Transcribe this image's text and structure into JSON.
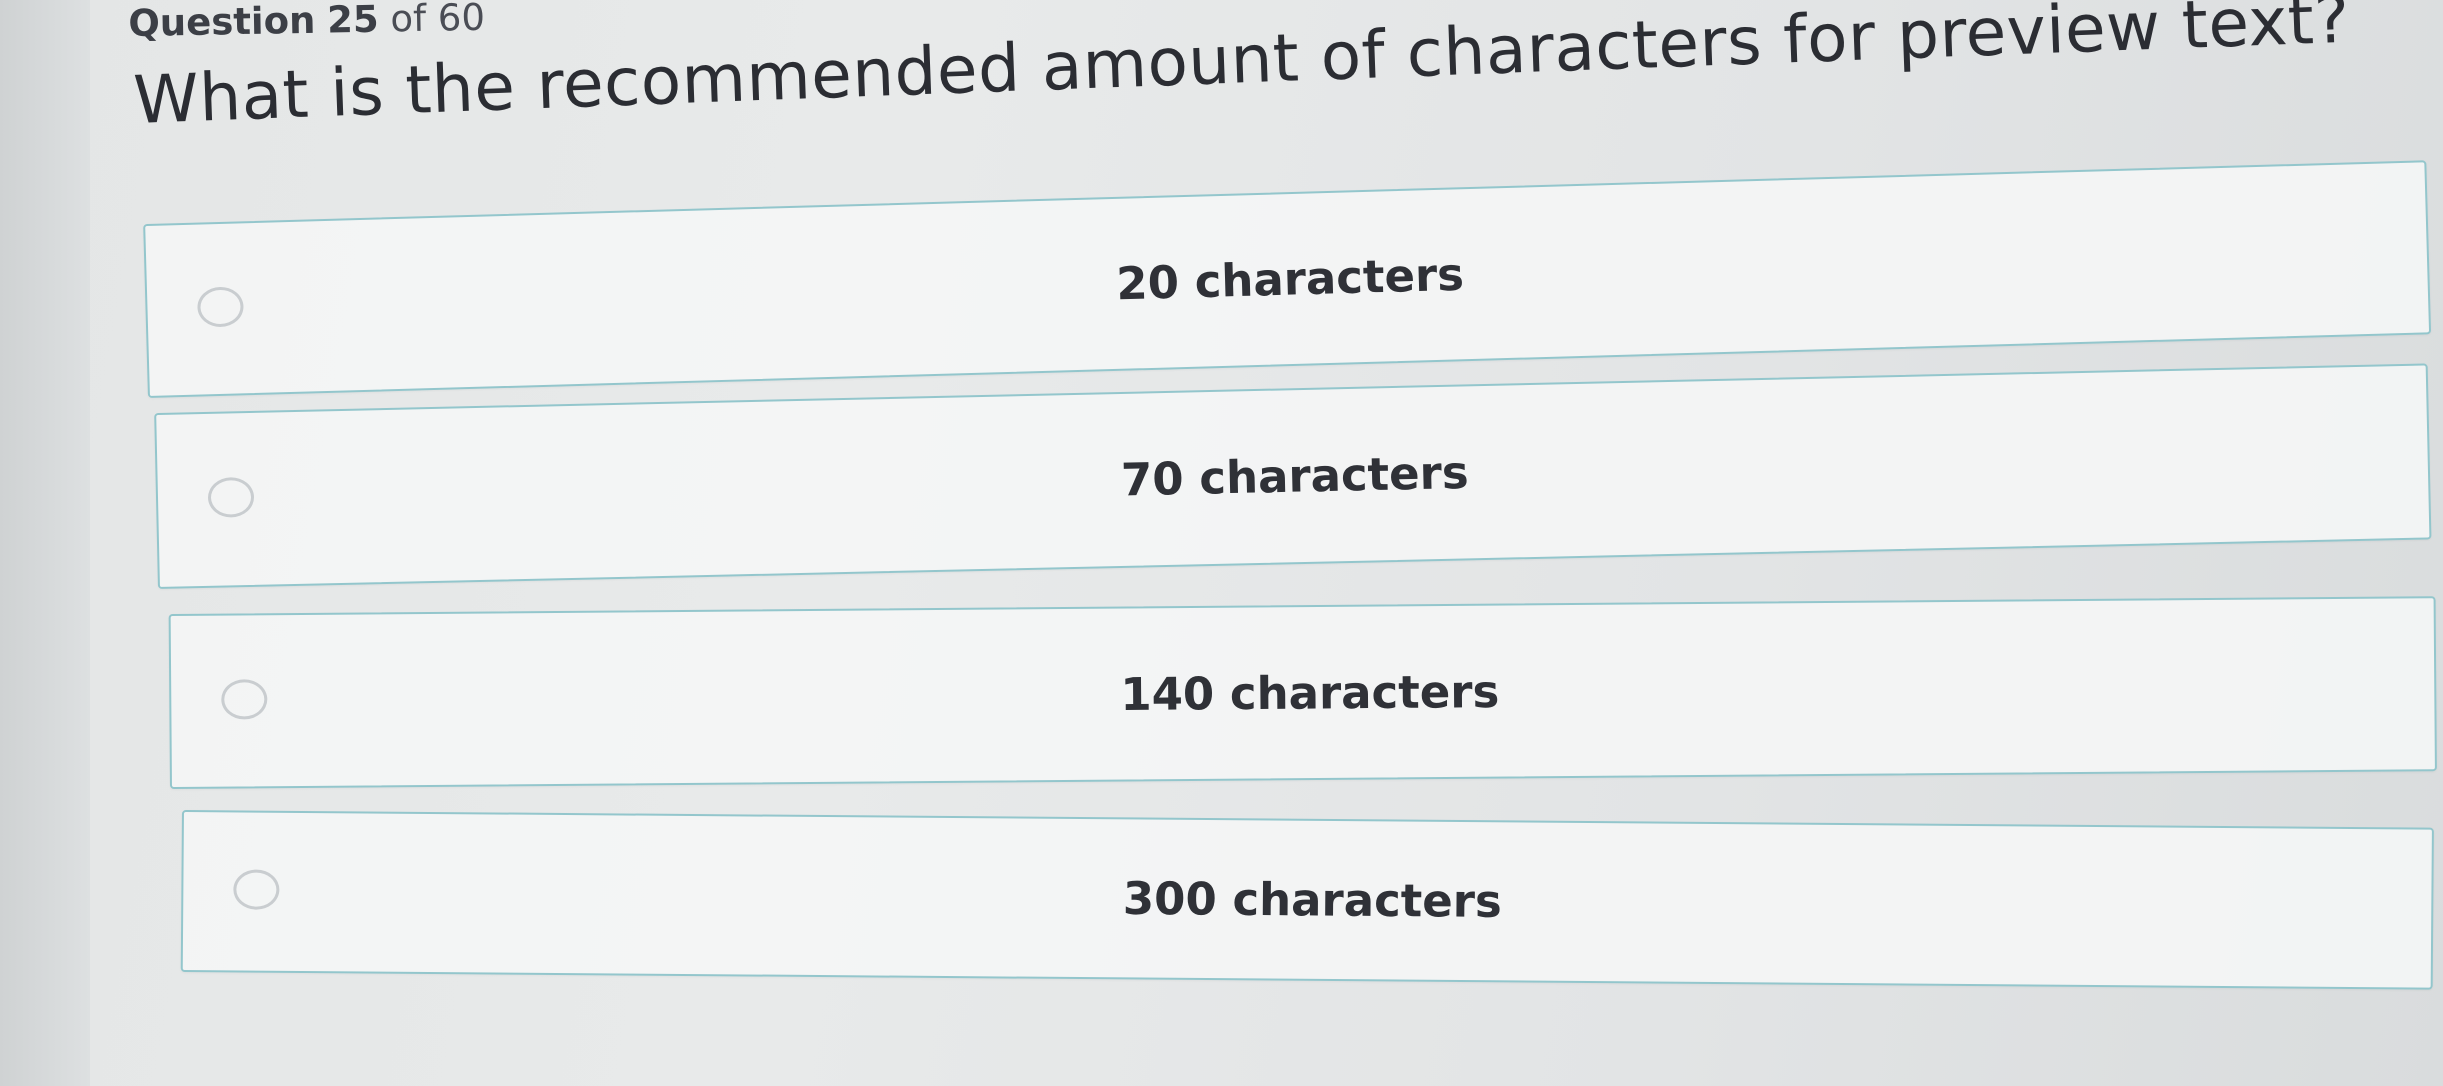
{
  "header": {
    "question_label": "Question",
    "question_number": "25",
    "of_total": "of 60"
  },
  "question": {
    "text": "What is the recommended amount of characters for preview text?"
  },
  "options": [
    {
      "label": "20 characters",
      "selected": false
    },
    {
      "label": "70 characters",
      "selected": false
    },
    {
      "label": "140 characters",
      "selected": false
    },
    {
      "label": "300 characters",
      "selected": false
    }
  ],
  "colors": {
    "option_border": "#93c6cc",
    "option_background": "#f4f5f5",
    "radio_border": "#c9cdd0",
    "text": "#2b2d33"
  },
  "icons": {
    "radio": "radio-unselected-icon"
  }
}
